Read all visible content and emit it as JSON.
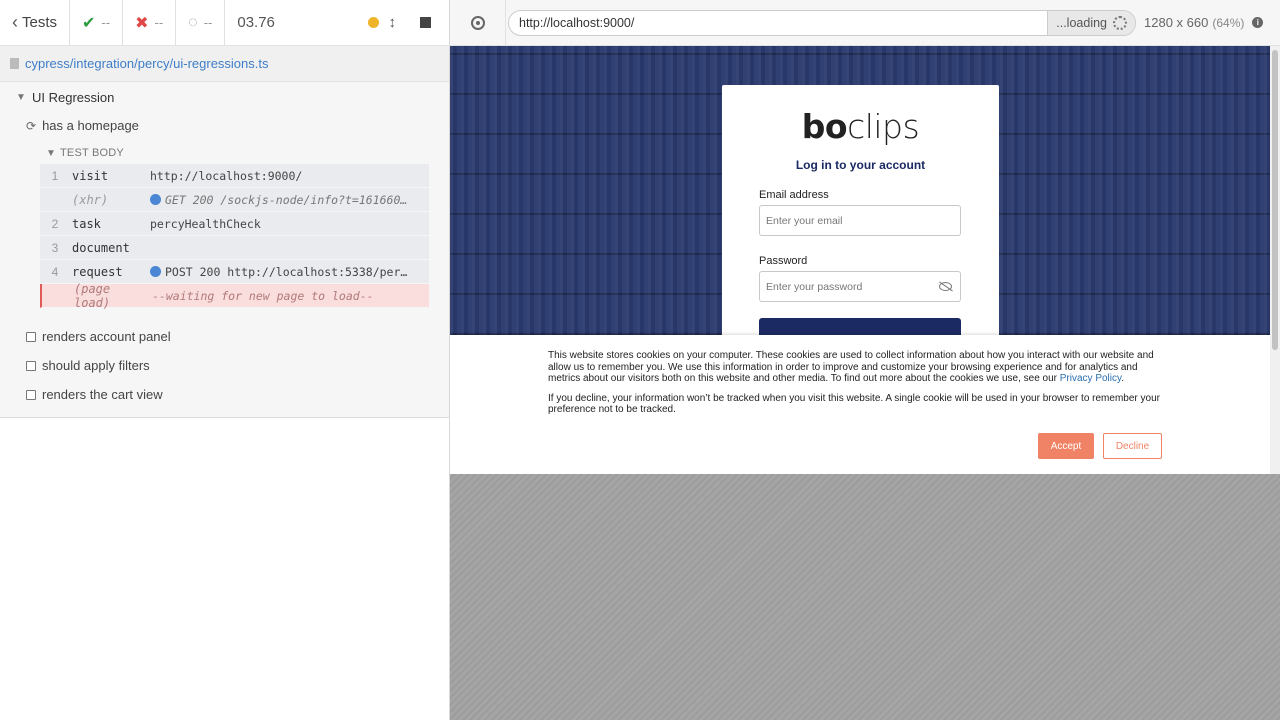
{
  "reporter": {
    "tests_label": "Tests",
    "passed": "--",
    "failed": "--",
    "pending": "--",
    "duration": "03.76",
    "spec_path": "cypress/integration/percy/ui-regressions.ts",
    "suite_title": "UI Regression",
    "active_test": "has a homepage",
    "test_body_label": "TEST BODY",
    "commands": [
      {
        "num": "1",
        "name": "visit",
        "message": "http://localhost:9000/"
      },
      {
        "num": "",
        "name": "(xhr)",
        "message": "GET 200 /sockjs-node/info?t=161660…"
      },
      {
        "num": "2",
        "name": "task",
        "message": "percyHealthCheck"
      },
      {
        "num": "3",
        "name": "document",
        "message": ""
      },
      {
        "num": "4",
        "name": "request",
        "message": "POST 200 http://localhost:5338/per…"
      },
      {
        "num": "",
        "name": "(page load)",
        "message": "--waiting for new page to load--"
      }
    ],
    "other_tests": [
      "renders account panel",
      "should apply filters",
      "renders the cart view"
    ]
  },
  "aut": {
    "url": "http://localhost:9000/",
    "loading_label": "...loading",
    "viewport": "1280 x 660",
    "scale": "(64%)"
  },
  "login": {
    "logo_b": "bo",
    "logo_rest": "clips",
    "title": "Log in to your account",
    "email_label": "Email address",
    "email_placeholder": "Enter your email",
    "password_label": "Password",
    "password_placeholder": "Enter your password"
  },
  "cookie": {
    "para1": "This website stores cookies on your computer. These cookies are used to collect information about how you interact with our website and allow us to remember you. We use this information in order to improve and customize your browsing experience and for analytics and metrics about our visitors both on this website and other media. To find out more about the cookies we use, see our",
    "privacy_link": "Privacy Policy",
    "para1_end": ".",
    "para2": "If you decline, your information won’t be tracked when you visit this website. A single cookie will be used in your browser to remember your preference not to be tracked.",
    "accept": "Accept",
    "decline": "Decline"
  },
  "colors": {
    "accent": "#f08365",
    "brand_navy": "#1b2a63",
    "pass": "#2b9b3e",
    "fail": "#e04747",
    "running": "#f0b429"
  }
}
